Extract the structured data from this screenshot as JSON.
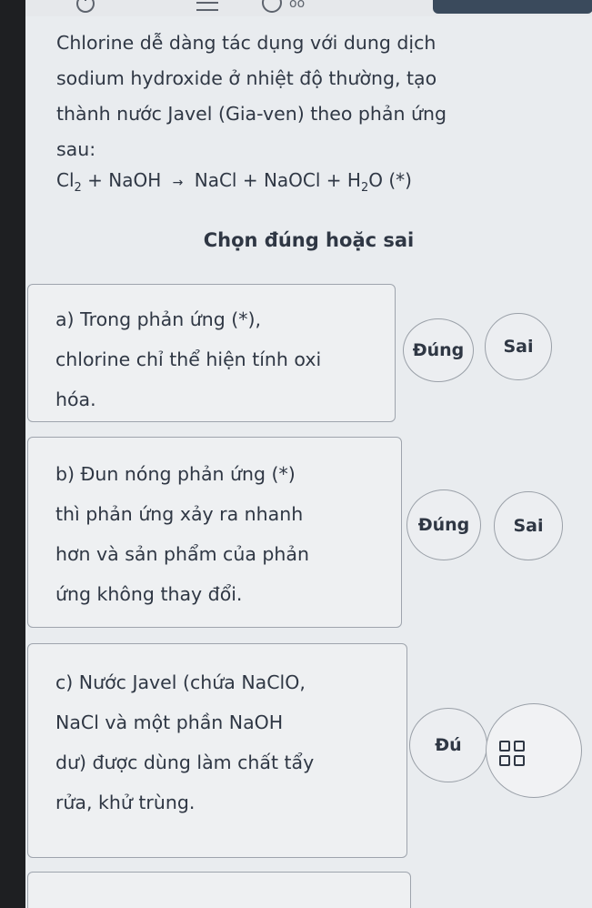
{
  "question": {
    "lines": [
      "Chlorine dễ dàng tác dụng với dung dịch",
      "sodium hydroxide ở nhiệt độ thường, tạo",
      "thành nước Javel (Gia-ven) theo phản ứng",
      "sau:"
    ],
    "equation": {
      "cl": "Cl",
      "cl_sub": "2",
      "reactant2": "+ NaOH",
      "arrow": "→",
      "products": "NaCl + NaOCl + H",
      "water_sub": "2",
      "tail": "O (*)"
    }
  },
  "instruction": "Chọn đúng hoặc sai",
  "items": [
    {
      "lines": [
        "a) Trong phản ứng (*),",
        "chlorine chỉ thể hiện tính oxi",
        "hóa."
      ],
      "true_label": "Đúng",
      "false_label": "Sai"
    },
    {
      "lines": [
        "b) Đun nóng phản ứng (*)",
        "thì phản ứng xảy ra nhanh",
        "hơn và sản phẩm của phản",
        "ứng không thay đổi."
      ],
      "true_label": "Đúng",
      "false_label": "Sai"
    },
    {
      "lines": [
        "c) Nước Javel (chứa NaClO,",
        "NaCl và một phần NaOH",
        "dư) được dùng làm chất tẩy",
        "rửa, khử trùng."
      ],
      "true_label": "Đú"
    }
  ],
  "icons": {
    "top": [
      "power-icon",
      "menu-icon",
      "clock-icon"
    ],
    "overlay": "grid-icon"
  },
  "colors": {
    "text": "#2f3744",
    "card_border": "#9ea4ad",
    "top_action": "#3a4a5c"
  }
}
